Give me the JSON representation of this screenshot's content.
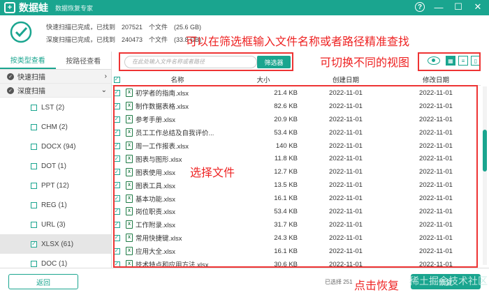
{
  "app": {
    "brand": "数据蛙",
    "subtitle": "数据恢复专家",
    "logo_text": "+"
  },
  "window": {
    "help_icon": "?",
    "min_icon": "—",
    "max_icon": "☐",
    "close_icon": "✕"
  },
  "scan": {
    "quick_line": "快速扫描已完成，已找到　207521　个文件　(25.6 GB)",
    "deep_line": "深度扫描已完成，已找到　240473　个文件　(33.8 GB)"
  },
  "annotations": {
    "search_hint": "可以在筛选框输入文件名称或者路径精准查找",
    "view_hint": "可切换不同的视图",
    "select_hint": "选择文件",
    "recover_hint": "点击恢复"
  },
  "sidebar": {
    "tabs": [
      {
        "label": "按类型查看"
      },
      {
        "label": "按路径查看"
      }
    ],
    "sections": [
      {
        "label": "快速扫描",
        "arrow": "›"
      },
      {
        "label": "深度扫描",
        "arrow": "⌄"
      }
    ],
    "types": [
      {
        "label": "LST (2)"
      },
      {
        "label": "CHM (2)"
      },
      {
        "label": "DOCX (94)"
      },
      {
        "label": "DOT (1)"
      },
      {
        "label": "PPT (12)"
      },
      {
        "label": "REG (1)"
      },
      {
        "label": "URL (3)"
      },
      {
        "label": "XLSX (61)"
      },
      {
        "label": "DOC (1)"
      }
    ]
  },
  "search": {
    "placeholder": "在此处输入文件名称或者路径"
  },
  "filter_button": "筛选器",
  "table": {
    "headers": {
      "name": "名称",
      "size": "大小",
      "created": "创建日期",
      "modified": "修改日期"
    },
    "rows": [
      {
        "name": "初学者的指南.xlsx",
        "size": "21.4 KB",
        "created": "2022-11-01",
        "modified": "2022-11-01"
      },
      {
        "name": "制作数据表格.xlsx",
        "size": "82.6 KB",
        "created": "2022-11-01",
        "modified": "2022-11-01"
      },
      {
        "name": "参考手册.xlsx",
        "size": "20.9 KB",
        "created": "2022-11-01",
        "modified": "2022-11-01"
      },
      {
        "name": "员工工作总结及自我评价...",
        "size": "53.4 KB",
        "created": "2022-11-01",
        "modified": "2022-11-01"
      },
      {
        "name": "周一工作报表.xlsx",
        "size": "140 KB",
        "created": "2022-11-01",
        "modified": "2022-11-01"
      },
      {
        "name": "图表与图形.xlsx",
        "size": "11.8 KB",
        "created": "2022-11-01",
        "modified": "2022-11-01"
      },
      {
        "name": "图表使用.xlsx",
        "size": "12.7 KB",
        "created": "2022-11-01",
        "modified": "2022-11-01"
      },
      {
        "name": "图表工具.xlsx",
        "size": "13.5 KB",
        "created": "2022-11-01",
        "modified": "2022-11-01"
      },
      {
        "name": "基本功能.xlsx",
        "size": "16.1 KB",
        "created": "2022-11-01",
        "modified": "2022-11-01"
      },
      {
        "name": "岗位职责.xlsx",
        "size": "53.4 KB",
        "created": "2022-11-01",
        "modified": "2022-11-01"
      },
      {
        "name": "工作附录.xlsx",
        "size": "31.7 KB",
        "created": "2022-11-01",
        "modified": "2022-11-01"
      },
      {
        "name": "常用快捷键.xlsx",
        "size": "24.3 KB",
        "created": "2022-11-01",
        "modified": "2022-11-01"
      },
      {
        "name": "应用大全.xlsx",
        "size": "16.1 KB",
        "created": "2022-11-01",
        "modified": "2022-11-01"
      },
      {
        "name": "技术特点和应用方法.xlsx",
        "size": "30.6 KB",
        "created": "2022-11-01",
        "modified": "2022-11-01"
      }
    ]
  },
  "bottom": {
    "back_label": "返回",
    "selected_info": "已选择 251",
    "recover_label": "恢复",
    "watermark": "稀土掘金技术社区"
  },
  "colors": {
    "accent": "#1aa58f",
    "annotation": "#e22222"
  }
}
